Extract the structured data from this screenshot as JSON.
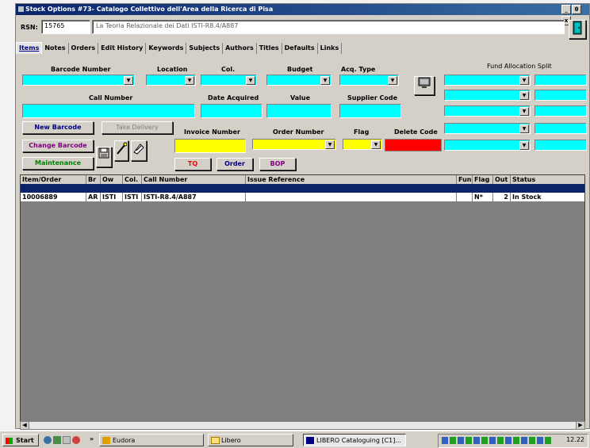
{
  "window": {
    "title": "Stock Options #73- Catalogo Collettivo dell'Area della Ricerca di Pisa",
    "controls": [
      "_",
      "θ",
      "x"
    ]
  },
  "rsn": {
    "label": "RSN:",
    "value": "15765",
    "title_value": "La Teoria Relazionale dei Dati ISTI-R8.4/A887"
  },
  "tabs": [
    "Items",
    "Notes",
    "Orders",
    "Edit History",
    "Keywords",
    "Subjects",
    "Authors",
    "Titles",
    "Defaults",
    "Links"
  ],
  "form": {
    "barcode_label": "Barcode Number",
    "location_label": "Location",
    "col_label": "Col.",
    "budget_label": "Budget",
    "acq_type_label": "Acq. Type",
    "fund_label": "Fund Allocation Split",
    "call_number_label": "Call Number",
    "date_acquired_label": "Date Acquired",
    "value_label": "Value",
    "supplier_code_label": "Supplier Code",
    "invoice_label": "Invoice Number",
    "order_number_label": "Order Number",
    "flag_label": "Flag",
    "delete_code_label": "Delete Code"
  },
  "buttons": {
    "new_barcode": "New Barcode",
    "take_delivery": "Take Delivery",
    "change_barcode": "Change Barcode",
    "maintenance": "Maintenance",
    "tq": "TQ",
    "order": "Order",
    "bop": "BOP"
  },
  "grid": {
    "columns": [
      "Item/Order",
      "Br",
      "Ow",
      "Col.",
      "Call Number",
      "Issue Reference",
      "Fun",
      "Flag",
      "Out",
      "Status"
    ],
    "rows": [
      {
        "item": "10006889",
        "br": "AR",
        "ow": "ISTI",
        "col": "ISTI",
        "call": "ISTI-R8.4/A887",
        "issue": "",
        "fun": "",
        "flag": "N*",
        "out": "2",
        "status": "In Stock"
      }
    ]
  },
  "taskbar": {
    "start": "Start",
    "items": [
      "Eudora",
      "Libero",
      "LIBERO Cataloguing [C1]..."
    ],
    "clock": "12.22"
  },
  "colors": {
    "cyan": "#00ffff",
    "yellow": "#ffff00",
    "red": "#ff0000",
    "titlebar": "#0a246a"
  }
}
